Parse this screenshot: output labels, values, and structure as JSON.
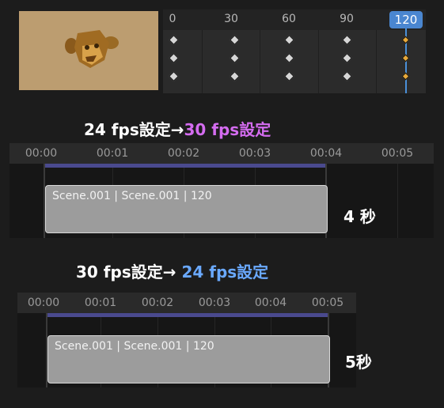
{
  "dopesheet": {
    "ticks": [
      "0",
      "30",
      "60",
      "90"
    ],
    "current_frame": "120"
  },
  "section1": {
    "heading_prefix": "24 fps設定→",
    "heading_highlight": "30 fps設定",
    "ruler": [
      "00:00",
      "00:01",
      "00:02",
      "00:03",
      "00:04",
      "00:05"
    ],
    "strip_label": "Scene.001 | Scene.001 | 120",
    "duration_label": "4 秒"
  },
  "section2": {
    "heading_prefix": "30 fps設定→",
    "heading_highlight": "24 fps設定",
    "ruler": [
      "00:00",
      "00:01",
      "00:02",
      "00:03",
      "00:04",
      "00:05"
    ],
    "strip_label": "Scene.001 | Scene.001 | 120",
    "duration_label": "5秒"
  },
  "colors": {
    "highlight_purple": "#d46cf0",
    "highlight_blue": "#6aa9ff",
    "playhead": "#4a86d0"
  }
}
